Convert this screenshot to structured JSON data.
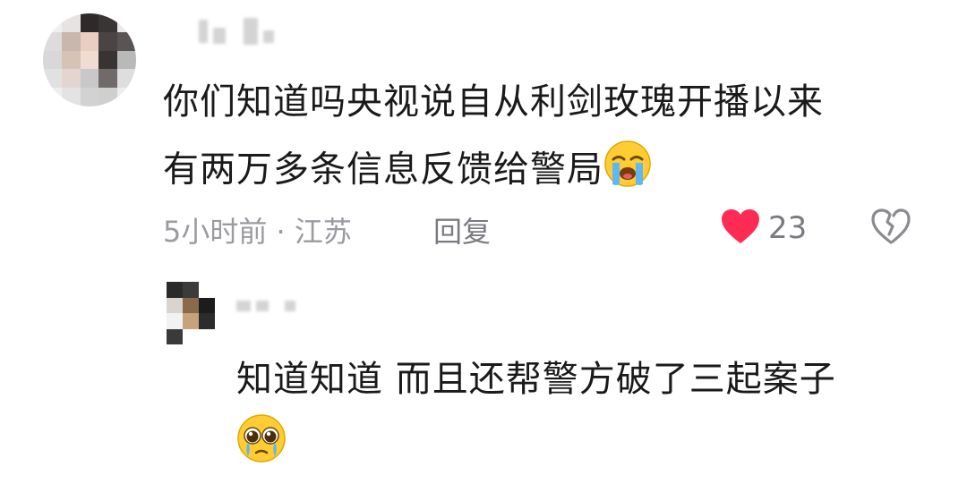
{
  "main_comment": {
    "line1": "你们知道吗央视说自从利剑玫瑰开播以来",
    "line2": "有两万多条信息反馈给警局",
    "emoji": "loudly-crying-face",
    "meta": "5小时前 · 江苏",
    "reply_label": "回复",
    "like_count": "23",
    "colors": {
      "like": "#fe2c55",
      "dislike": "#7a7b80",
      "meta": "#9a9ba0"
    }
  },
  "reply_comment": {
    "line1": "知道知道 而且还帮警方破了三起案子",
    "emoji": "pleading-face"
  }
}
